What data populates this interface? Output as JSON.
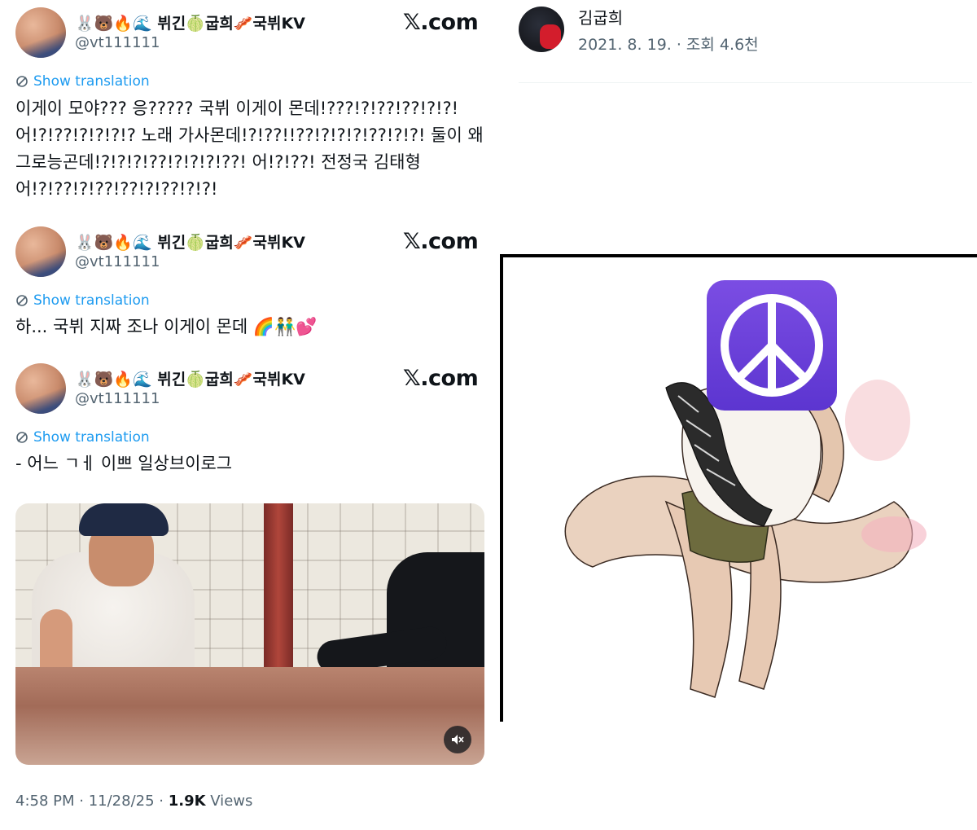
{
  "tweets": [
    {
      "display_name": "🐰🐻🔥🌊 뷔긴🍈굽희🥓국뷔KV",
      "handle": "@vt111111",
      "brand": "𝕏.com",
      "translate": "Show translation",
      "text_lines": [
        "이게이 모야??? 응????? 국뷔 이게이 몬데!???!?!??!??!?!?!",
        "어!?!??!?!?!?!? 노래 가사몬데!?!??!!??!?!?!?!??!?!?! 둘이 왜",
        "그로능곤데!?!?!?!??!?!?!?!??! 어!?!??! 전정국 김태형",
        "어!?!??!?!??!??!?!??!?!?!"
      ]
    },
    {
      "display_name": "🐰🐻🔥🌊 뷔긴🍈굽희🥓국뷔KV",
      "handle": "@vt111111",
      "brand": "𝕏.com",
      "translate": "Show translation",
      "text_lines": [
        "하...  국뷔 지짜 조나 이게이 몬데 🌈👬💕"
      ]
    },
    {
      "display_name": "🐰🐻🔥🌊 뷔긴🍈굽희🥓국뷔KV",
      "handle": "@vt111111",
      "brand": "𝕏.com",
      "translate": "Show translation",
      "text_lines": [
        "- 어느 ㄱㅔ 이쁘 일상브이로그"
      ],
      "meta_time": "4:58 PM · 11/28/25 · ",
      "meta_views_count": "1.9K",
      "meta_views_label": " Views"
    }
  ],
  "right_post": {
    "name": "김굽희",
    "date": "2021. 8. 19. · 조회 4.6천"
  },
  "icons": {
    "translate": "translate-globe-icon",
    "mute": "muted-speaker-icon",
    "peace": "peace-sign-icon"
  },
  "colors": {
    "link_blue": "#1d9bf0",
    "secondary_gray": "#536471",
    "peace_purple": "#6a3fda"
  }
}
